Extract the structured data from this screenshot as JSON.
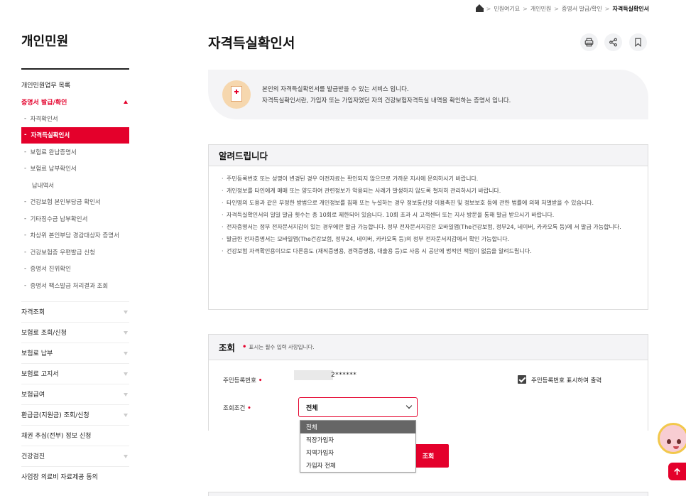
{
  "breadcrumb": {
    "items": [
      "민원여기요",
      "개인민원",
      "증명서 발급/확인"
    ],
    "current": "자격득실확인서"
  },
  "sidebar": {
    "title": "개인민원",
    "overview": "개인민원업무 목록",
    "open_section": "증명서 발급/확인",
    "sub_items": [
      {
        "label": "자격확인서",
        "active": false
      },
      {
        "label": "자격득실확인서",
        "active": true
      },
      {
        "label": "보험료 완납증명서",
        "active": false
      },
      {
        "label": "보험료 납부확인서",
        "active": false
      },
      {
        "label": "납내역서",
        "active": false
      },
      {
        "label": "건강보험 본인부담금 확인서",
        "active": false
      },
      {
        "label": "기타징수금 납부확인서",
        "active": false
      },
      {
        "label": "차상위 본인부담 경감대상자 증명서",
        "active": false
      },
      {
        "label": "건강보험증 우편발급 신청",
        "active": false
      },
      {
        "label": "증명서 진위확인",
        "active": false
      },
      {
        "label": "증명서 팩스발급 처리결과 조회",
        "active": false
      }
    ],
    "categories": [
      {
        "label": "자격조회",
        "has_caret": true
      },
      {
        "label": "보험료 조회/신청",
        "has_caret": true
      },
      {
        "label": "보험료 납부",
        "has_caret": true
      },
      {
        "label": "보험료 고지서",
        "has_caret": true
      },
      {
        "label": "보험급여",
        "has_caret": true
      },
      {
        "label": "환급금(지원금) 조회/신청",
        "has_caret": true
      },
      {
        "label": "채권 추심(전부) 정보 신청",
        "has_caret": false
      },
      {
        "label": "건강검진",
        "has_caret": true
      },
      {
        "label": "사업장 의료비 자료제공 동의",
        "has_caret": false
      }
    ]
  },
  "page": {
    "title": "자격득실확인서"
  },
  "tools": {
    "print": "print-icon",
    "share": "share-icon",
    "bookmark": "bookmark-icon"
  },
  "intro": {
    "line1": "본인의 자격득실확인서를 발급받을 수 있는 서비스 입니다.",
    "line2": "자격득실확인서란, 가입자 또는 가입자였던 자의 건강보험자격득실 내역을 확인하는 증명서 입니다."
  },
  "notice": {
    "title": "알려드립니다",
    "items": [
      "주민등록번호 또는 성명이 변경된 경우 이전자료는 확인되지 않으므로 가까운 지사에 문의하시기 바랍니다.",
      "개인정보를 타인에게 매매 또는 양도하여 관련정보가 악용되는 사례가 발생하지 않도록 철저히 관리하시기 바랍니다.",
      "타인명의 도용과 같은 부정한 방법으로 개인정보를 침해 또는 누설하는 경우 정보통신망 이용촉진 및 정보보호 등에 관한 법률에 의해 처벌받을 수 있습니다.",
      "자격득실확인서의 일일 발급 횟수는 총 10회로 제한되어 있습니다. 10회 초과 시 고객센터 또는 지사 방문을 통해 발급 받으시기 바랍니다.",
      "전자증명서는 정부 전자문서지갑이 있는 경우에만 발급 가능합니다. 정부 전자문서지갑은 모바일앱(The건강보험, 정부24, 네이버, 카카오톡 등)에 서 발급 가능합니다.",
      "발급한 전자증명서는 모바일앱(The건강보험, 정부24, 네이버, 카카오톡 등)의 정부 전자문서지갑에서 확인 가능합니다.",
      "건강보험 자격확인용이므로 다른용도 (재직증명용, 경력증명용, 대출용 등)로 사용 시 공단에 법적인 책임이 없음을 알려드립니다."
    ]
  },
  "query": {
    "title": "조회",
    "required_note": "표시는 필수 입력 사항입니다.",
    "rrn_label": "주민등록번호",
    "rrn_value": "2******",
    "rrn_show_label": "주민등록번호 표시하여 출력",
    "rrn_show_checked": true,
    "condition_label": "조회조건",
    "selected": "전체",
    "options": [
      "전체",
      "직장가입자",
      "지역가입자",
      "가입자 전체"
    ],
    "search_label": "조회"
  },
  "colors": {
    "accent": "#e4002b",
    "panel_bg": "#f4f4f6"
  },
  "widgets": {
    "mascot": "mascot-icon",
    "scroll_top": "arrow-up-icon"
  }
}
